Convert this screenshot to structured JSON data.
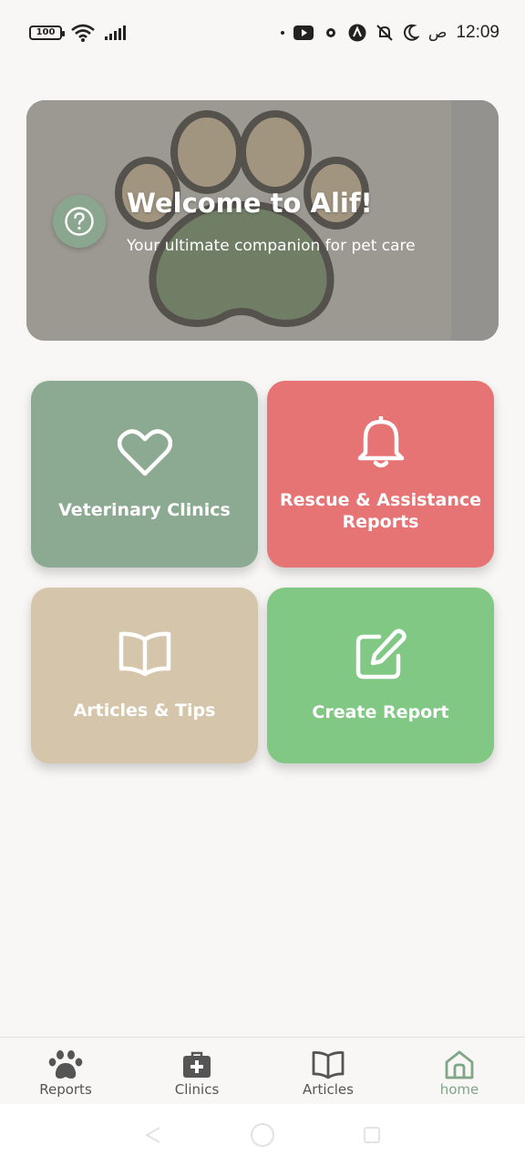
{
  "status_bar": {
    "battery": "100",
    "time": "12:09",
    "ampm": "ص"
  },
  "hero": {
    "title": "Welcome to Alif!",
    "subtitle": "Your ultimate companion for pet care"
  },
  "cards": {
    "vet": "Veterinary Clinics",
    "rescue": "Rescue & Assistance Reports",
    "articles": "Articles & Tips",
    "create": "Create Report"
  },
  "bottom_nav": {
    "items": [
      {
        "label": "Reports",
        "icon": "paw-icon"
      },
      {
        "label": "Clinics",
        "icon": "medical-bag-icon"
      },
      {
        "label": "Articles",
        "icon": "book-icon"
      },
      {
        "label": "home",
        "icon": "home-icon"
      }
    ],
    "active_index": 3
  },
  "colors": {
    "accent_green": "#8caa91",
    "rescue_red": "#e77474",
    "articles_beige": "#d5c6ab",
    "create_green": "#80c883",
    "active_nav": "#7ea687"
  }
}
